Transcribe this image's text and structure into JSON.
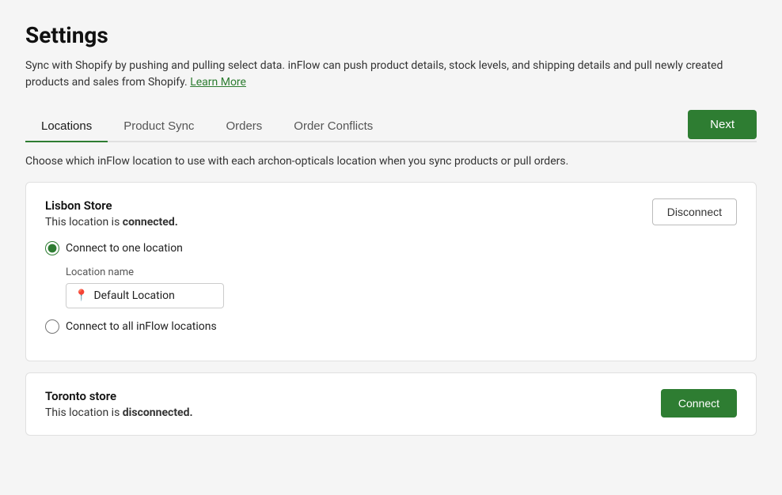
{
  "page": {
    "title": "Settings",
    "description": "Sync with Shopify by pushing and pulling select data. inFlow can push product details, stock levels, and shipping details and pull newly created products and sales from Shopify.",
    "learn_more_label": "Learn More",
    "sub_description": "Choose which inFlow location to use with each archon-opticals location when you sync products or pull orders."
  },
  "tabs": [
    {
      "id": "locations",
      "label": "Locations",
      "active": true
    },
    {
      "id": "product-sync",
      "label": "Product Sync",
      "active": false
    },
    {
      "id": "orders",
      "label": "Orders",
      "active": false
    },
    {
      "id": "order-conflicts",
      "label": "Order Conflicts",
      "active": false
    }
  ],
  "next_button_label": "Next",
  "locations": [
    {
      "id": "lisbon",
      "name": "Lisbon Store",
      "status_prefix": "This location is",
      "status": "connected.",
      "connected": true,
      "action_label": "Disconnect",
      "radio_options": [
        {
          "id": "one-location",
          "label": "Connect to one location",
          "selected": true
        },
        {
          "id": "all-locations",
          "label": "Connect to all inFlow locations",
          "selected": false
        }
      ],
      "location_name_label": "Location name",
      "location_name_value": "Default Location"
    },
    {
      "id": "toronto",
      "name": "Toronto store",
      "status_prefix": "This location is",
      "status": "disconnected.",
      "connected": false,
      "action_label": "Connect"
    }
  ],
  "icons": {
    "pin": "📍"
  }
}
